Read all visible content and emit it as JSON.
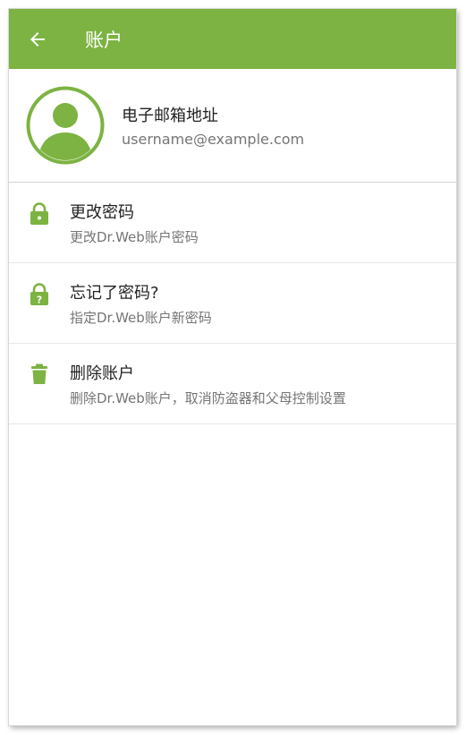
{
  "appbar": {
    "title": "账户",
    "color": "#7cb342"
  },
  "account": {
    "email_title": "电子邮箱地址",
    "email_value": "username@example.com",
    "avatar_icon": "user-avatar-icon"
  },
  "items": [
    {
      "title": "更改密码",
      "subtitle": "更改Dr.Web账户密码",
      "icon": "lock-icon"
    },
    {
      "title": "忘记了密码?",
      "subtitle": "指定Dr.Web账户新密码",
      "icon": "lock-question-icon"
    },
    {
      "title": "删除账户",
      "subtitle": "删除Dr.Web账户，取消防盗器和父母控制设置",
      "icon": "trash-icon"
    }
  ]
}
